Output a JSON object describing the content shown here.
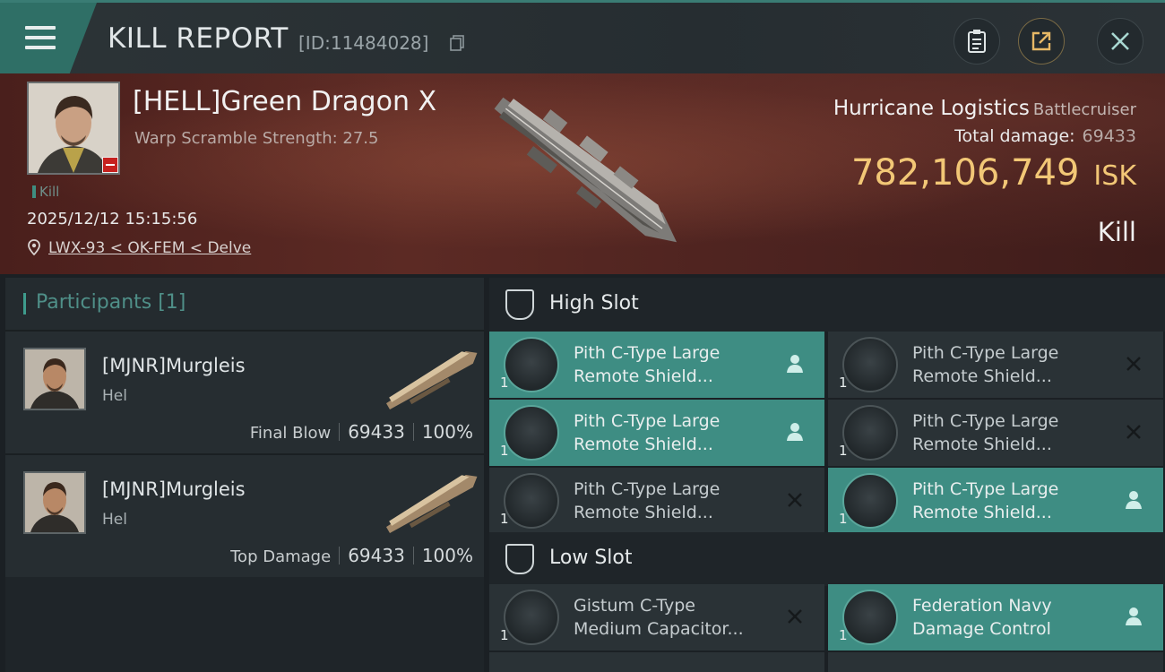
{
  "header": {
    "title": "KILL REPORT",
    "report_id": "[ID:11484028]",
    "icons": [
      "menu-icon",
      "copy-icon",
      "clipboard-icon",
      "share-icon",
      "close-icon"
    ]
  },
  "victim": {
    "name": "[HELL]Green Dragon X",
    "warp_scramble": "Warp Scramble Strength: 27.5",
    "tag": "Kill",
    "datetime": "2025/12/12 15:15:56",
    "location": "LWX-93 < OK-FEM < Delve",
    "ship_name": "Hurricane Logistics",
    "ship_class": "Battlecruiser",
    "total_damage_label": "Total damage:",
    "total_damage_value": "69433",
    "isk_value": "782,106,749",
    "isk_unit": "ISK",
    "result": "Kill"
  },
  "participants": {
    "title": "Participants [1]",
    "rows": [
      {
        "name": "[MJNR]Murgleis",
        "ship": "Hel",
        "role": "Final Blow",
        "damage": "69433",
        "percent": "100%"
      },
      {
        "name": "[MJNR]Murgleis",
        "ship": "Hel",
        "role": "Top Damage",
        "damage": "69433",
        "percent": "100%"
      }
    ]
  },
  "high_slot": {
    "label": "High Slot",
    "modules": [
      {
        "line1": "Pith C-Type Large",
        "line2": "Remote Shield...",
        "qty": "1",
        "status": "fitted"
      },
      {
        "line1": "Pith C-Type Large",
        "line2": "Remote Shield...",
        "qty": "1",
        "status": "destroyed"
      },
      {
        "line1": "Pith C-Type Large",
        "line2": "Remote Shield...",
        "qty": "1",
        "status": "fitted"
      },
      {
        "line1": "Pith C-Type Large",
        "line2": "Remote Shield...",
        "qty": "1",
        "status": "destroyed"
      },
      {
        "line1": "Pith C-Type Large",
        "line2": "Remote Shield...",
        "qty": "1",
        "status": "destroyed"
      },
      {
        "line1": "Pith C-Type Large",
        "line2": "Remote Shield...",
        "qty": "1",
        "status": "fitted"
      }
    ]
  },
  "low_slot": {
    "label": "Low Slot",
    "modules": [
      {
        "line1": "Gistum C-Type",
        "line2": "Medium Capacitor...",
        "qty": "1",
        "status": "destroyed"
      },
      {
        "line1": "Federation Navy",
        "line2": "Damage Control",
        "qty": "1",
        "status": "fitted"
      }
    ]
  },
  "colors": {
    "accent_teal": "#3e8d83",
    "isk_gold": "#f2c776",
    "banner_red": "#5c2a24",
    "badge_red": "#c6221f"
  }
}
